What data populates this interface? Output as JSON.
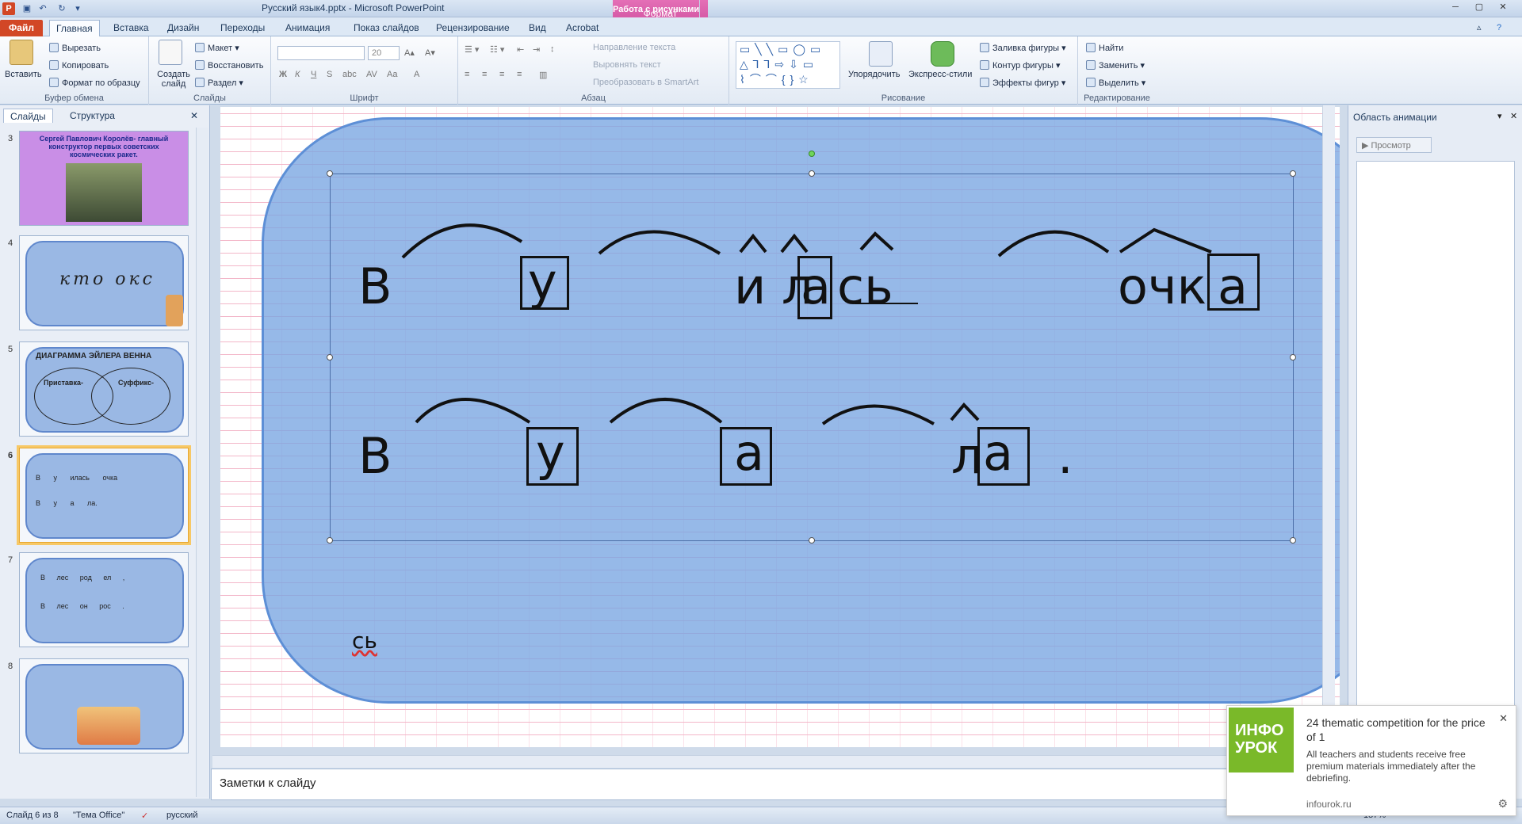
{
  "titlebar": {
    "title": "Русский язык4.pptx - Microsoft PowerPoint",
    "context_group": "Работа с рисунками",
    "context_tab": "Формат"
  },
  "tabs": [
    "Файл",
    "Главная",
    "Вставка",
    "Дизайн",
    "Переходы",
    "Анимация",
    "Показ слайдов",
    "Рецензирование",
    "Вид",
    "Acrobat"
  ],
  "ribbon": {
    "clipboard": {
      "paste": "Вставить",
      "cut": "Вырезать",
      "copy": "Копировать",
      "format_painter": "Формат по образцу",
      "label": "Буфер обмена"
    },
    "slides": {
      "new_slide": "Создать слайд",
      "layout": "Макет",
      "reset": "Восстановить",
      "section": "Раздел",
      "label": "Слайды"
    },
    "font": {
      "size": "20",
      "label": "Шрифт"
    },
    "paragraph": {
      "text_direction": "Направление текста",
      "align_text": "Выровнять текст",
      "smartart": "Преобразовать в SmartArt",
      "label": "Абзац"
    },
    "drawing": {
      "arrange": "Упорядочить",
      "quick_styles": "Экспресс-стили",
      "shape_fill": "Заливка фигуры",
      "shape_outline": "Контур фигуры",
      "shape_effects": "Эффекты фигур",
      "label": "Рисование"
    },
    "editing": {
      "find": "Найти",
      "replace": "Заменить",
      "select": "Выделить",
      "label": "Редактирование"
    }
  },
  "left_pane": {
    "tab_slides": "Слайды",
    "tab_outline": "Структура",
    "thumbs": [
      {
        "num": "3",
        "title": "Сергей Павлович Королёв- главный конструктор первых советских космических ракет."
      },
      {
        "num": "4",
        "text": "кто окс"
      },
      {
        "num": "5",
        "title": "ДИАГРАММА ЭЙЛЕРА ВЕННА",
        "left": "Приставка-",
        "right": "Суффикс-"
      },
      {
        "num": "6",
        "line1": "В у илась очка",
        "line2": "В у а ла."
      },
      {
        "num": "7",
        "line1": "В лес род ел ,",
        "line2": "В лес он рос ."
      },
      {
        "num": "8"
      }
    ]
  },
  "slide": {
    "row1": {
      "w1": "В",
      "w2": "у",
      "w3": "и л",
      "w4": "а",
      "w5": "сь",
      "w6": "очк",
      "w7": "а"
    },
    "row2": {
      "w1": "В",
      "w2": "у",
      "w3": "а",
      "w4": "л",
      "w5": "а",
      "w6": "."
    },
    "bottom_text": "сь"
  },
  "notes_placeholder": "Заметки к слайду",
  "right_pane": {
    "title": "Область анимации",
    "preview": "Просмотр"
  },
  "status": {
    "slide_info": "Слайд 6 из 8",
    "theme": "\"Тема Office\"",
    "language": "русский",
    "zoom": "157%"
  },
  "toast": {
    "logo": "ИНФО УРОК",
    "title": "24 thematic competition for the price of 1",
    "body": "All teachers and students receive free premium materials immediately after the debriefing.",
    "site": "infourok.ru"
  }
}
